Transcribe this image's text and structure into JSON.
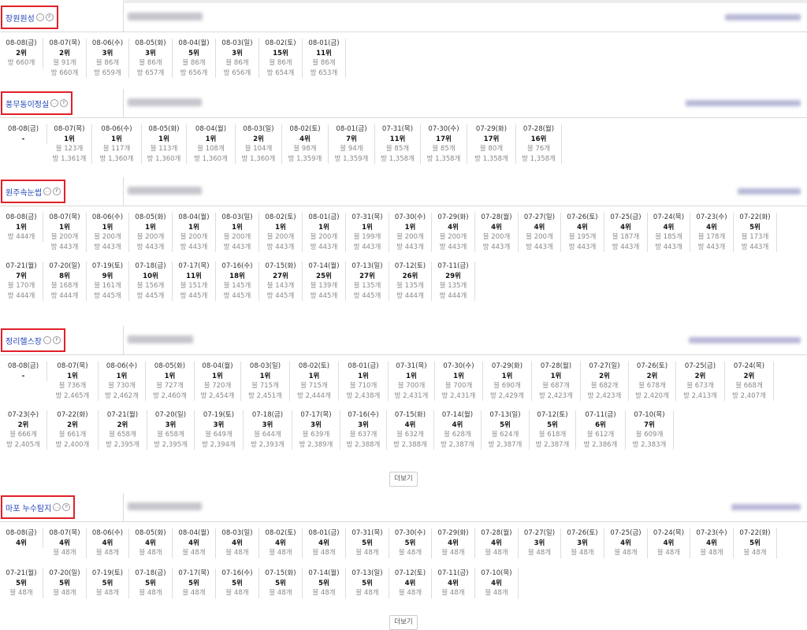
{
  "more_label": "더보기",
  "sections": [
    {
      "keyword": "장원원성",
      "data": [
        [
          "08-08(금)",
          "2위",
          "방 660개"
        ],
        [
          "08-07(목)",
          "2위",
          "블 91개",
          "방 660개"
        ],
        [
          "08-06(수)",
          "3위",
          "블 86개",
          "방 659개"
        ],
        [
          "08-05(화)",
          "3위",
          "블 86개",
          "방 657개"
        ],
        [
          "08-04(월)",
          "5위",
          "블 86개",
          "방 656개"
        ],
        [
          "08-03(일)",
          "3위",
          "블 86개",
          "방 656개"
        ],
        [
          "08-02(토)",
          "15위",
          "블 86개",
          "방 654개"
        ],
        [
          "08-01(금)",
          "11위",
          "블 86개",
          "방 653개"
        ]
      ]
    },
    {
      "keyword": "풍무동이정실",
      "data": [
        [
          "08-08(금)",
          "-"
        ],
        [
          "08-07(목)",
          "1위",
          "블 123개",
          "방 1,361개"
        ],
        [
          "08-06(수)",
          "1위",
          "블 117개",
          "방 1,360개"
        ],
        [
          "08-05(화)",
          "1위",
          "블 113개",
          "방 1,360개"
        ],
        [
          "08-04(월)",
          "1위",
          "블 108개",
          "방 1,360개"
        ],
        [
          "08-03(일)",
          "2위",
          "블 104개",
          "방 1,360개"
        ],
        [
          "08-02(토)",
          "4위",
          "블 98개",
          "방 1,359개"
        ],
        [
          "08-01(금)",
          "7위",
          "블 94개",
          "방 1,359개"
        ],
        [
          "07-31(목)",
          "11위",
          "블 85개",
          "방 1,358개"
        ],
        [
          "07-30(수)",
          "17위",
          "블 85개",
          "방 1,358개"
        ],
        [
          "07-29(화)",
          "17위",
          "블 80개",
          "방 1,358개"
        ],
        [
          "07-28(월)",
          "16위",
          "블 76개",
          "방 1,358개"
        ]
      ]
    },
    {
      "keyword": "원주속눈썹",
      "data": [
        [
          "08-08(금)",
          "1위",
          "방 444개"
        ],
        [
          "08-07(목)",
          "1위",
          "블 200개",
          "방 443개"
        ],
        [
          "08-06(수)",
          "1위",
          "블 200개",
          "방 443개"
        ],
        [
          "08-05(화)",
          "1위",
          "블 200개",
          "방 443개"
        ],
        [
          "08-04(월)",
          "1위",
          "블 200개",
          "방 443개"
        ],
        [
          "08-03(일)",
          "1위",
          "블 200개",
          "방 443개"
        ],
        [
          "08-02(토)",
          "1위",
          "블 200개",
          "방 443개"
        ],
        [
          "08-01(금)",
          "1위",
          "블 200개",
          "방 443개"
        ],
        [
          "07-31(목)",
          "1위",
          "블 199개",
          "방 443개"
        ],
        [
          "07-30(수)",
          "1위",
          "블 200개",
          "방 443개"
        ],
        [
          "07-29(화)",
          "4위",
          "블 200개",
          "방 443개"
        ],
        [
          "07-28(월)",
          "4위",
          "블 200개",
          "방 443개"
        ],
        [
          "07-27(일)",
          "4위",
          "블 200개",
          "방 443개"
        ],
        [
          "07-26(토)",
          "4위",
          "블 195개",
          "방 443개"
        ],
        [
          "07-25(금)",
          "4위",
          "블 187개",
          "방 443개"
        ],
        [
          "07-24(목)",
          "4위",
          "블 185개",
          "방 443개"
        ],
        [
          "07-23(수)",
          "4위",
          "블 178개",
          "방 443개"
        ],
        [
          "07-22(화)",
          "5위",
          "블 173개",
          "방 443개"
        ],
        [
          "07-21(월)",
          "7위",
          "블 170개",
          "방 444개"
        ],
        [
          "07-20(일)",
          "8위",
          "블 168개",
          "방 444개"
        ],
        [
          "07-19(토)",
          "9위",
          "블 161개",
          "방 445개"
        ],
        [
          "07-18(금)",
          "10위",
          "블 156개",
          "방 445개"
        ],
        [
          "07-17(목)",
          "11위",
          "블 151개",
          "방 445개"
        ],
        [
          "07-16(수)",
          "18위",
          "블 145개",
          "방 445개"
        ],
        [
          "07-15(화)",
          "27위",
          "블 143개",
          "방 445개"
        ],
        [
          "07-14(월)",
          "25위",
          "블 139개",
          "방 445개"
        ],
        [
          "07-13(일)",
          "27위",
          "블 135개",
          "방 445개"
        ],
        [
          "07-12(토)",
          "26위",
          "블 135개",
          "방 444개"
        ],
        [
          "07-11(금)",
          "29위",
          "블 135개",
          "방 444개"
        ]
      ]
    },
    {
      "keyword": "정리헬스장",
      "data": [
        [
          "08-08(금)",
          "-"
        ],
        [
          "08-07(목)",
          "1위",
          "블 736개",
          "방 2,465개"
        ],
        [
          "08-06(수)",
          "1위",
          "블 730개",
          "방 2,462개"
        ],
        [
          "08-05(화)",
          "1위",
          "블 727개",
          "방 2,460개"
        ],
        [
          "08-04(월)",
          "1위",
          "블 720개",
          "방 2,454개"
        ],
        [
          "08-03(일)",
          "1위",
          "블 715개",
          "방 2,451개"
        ],
        [
          "08-02(토)",
          "1위",
          "블 715개",
          "방 2,444개"
        ],
        [
          "08-01(금)",
          "1위",
          "블 710개",
          "방 2,438개"
        ],
        [
          "07-31(목)",
          "1위",
          "블 700개",
          "방 2,431개"
        ],
        [
          "07-30(수)",
          "1위",
          "블 700개",
          "방 2,431개"
        ],
        [
          "07-29(화)",
          "1위",
          "블 690개",
          "방 2,429개"
        ],
        [
          "07-28(월)",
          "1위",
          "블 687개",
          "방 2,423개"
        ],
        [
          "07-27(일)",
          "2위",
          "블 682개",
          "방 2,423개"
        ],
        [
          "07-26(토)",
          "2위",
          "블 678개",
          "방 2,420개"
        ],
        [
          "07-25(금)",
          "2위",
          "블 673개",
          "방 2,413개"
        ],
        [
          "07-24(목)",
          "2위",
          "블 668개",
          "방 2,407개"
        ],
        [
          "07-23(수)",
          "2위",
          "블 666개",
          "방 2,405개"
        ],
        [
          "07-22(화)",
          "2위",
          "블 661개",
          "방 2,400개"
        ],
        [
          "07-21(월)",
          "2위",
          "블 658개",
          "방 2,395개"
        ],
        [
          "07-20(일)",
          "3위",
          "블 658개",
          "방 2,395개"
        ],
        [
          "07-19(토)",
          "3위",
          "블 649개",
          "방 2,394개"
        ],
        [
          "07-18(금)",
          "3위",
          "블 644개",
          "방 2,393개"
        ],
        [
          "07-17(목)",
          "3위",
          "블 639개",
          "방 2,389개"
        ],
        [
          "07-16(수)",
          "3위",
          "블 637개",
          "방 2,388개"
        ],
        [
          "07-15(화)",
          "4위",
          "블 632개",
          "방 2,388개"
        ],
        [
          "07-14(월)",
          "4위",
          "블 628개",
          "방 2,387개"
        ],
        [
          "07-13(일)",
          "5위",
          "블 624개",
          "방 2,387개"
        ],
        [
          "07-12(토)",
          "5위",
          "블 618개",
          "방 2,387개"
        ],
        [
          "07-11(금)",
          "6위",
          "블 612개",
          "방 2,386개"
        ],
        [
          "07-10(목)",
          "7위",
          "블 609개",
          "방 2,383개"
        ]
      ]
    },
    {
      "keyword": "마포 누수탐지",
      "data": [
        [
          "08-08(금)",
          "4위"
        ],
        [
          "08-07(목)",
          "4위",
          "블 48개"
        ],
        [
          "08-06(수)",
          "4위",
          "블 48개"
        ],
        [
          "08-05(화)",
          "4위",
          "블 48개"
        ],
        [
          "08-04(월)",
          "4위",
          "블 48개"
        ],
        [
          "08-03(일)",
          "4위",
          "블 48개"
        ],
        [
          "08-02(토)",
          "4위",
          "블 48개"
        ],
        [
          "08-01(금)",
          "4위",
          "블 48개"
        ],
        [
          "07-31(목)",
          "5위",
          "블 48개"
        ],
        [
          "07-30(수)",
          "5위",
          "블 48개"
        ],
        [
          "07-29(화)",
          "4위",
          "블 48개"
        ],
        [
          "07-28(월)",
          "4위",
          "블 48개"
        ],
        [
          "07-27(일)",
          "3위",
          "블 48개"
        ],
        [
          "07-26(토)",
          "3위",
          "블 48개"
        ],
        [
          "07-25(금)",
          "4위",
          "블 48개"
        ],
        [
          "07-24(목)",
          "4위",
          "블 48개"
        ],
        [
          "07-23(수)",
          "4위",
          "블 48개"
        ],
        [
          "07-22(화)",
          "5위",
          "블 48개"
        ],
        [
          "07-21(월)",
          "5위",
          "블 48개"
        ],
        [
          "07-20(일)",
          "5위",
          "블 48개"
        ],
        [
          "07-19(토)",
          "5위",
          "블 48개"
        ],
        [
          "07-18(금)",
          "5위",
          "블 48개"
        ],
        [
          "07-17(목)",
          "5위",
          "블 48개"
        ],
        [
          "07-16(수)",
          "5위",
          "블 48개"
        ],
        [
          "07-15(화)",
          "5위",
          "블 48개"
        ],
        [
          "07-14(월)",
          "5위",
          "블 48개"
        ],
        [
          "07-13(일)",
          "5위",
          "블 48개"
        ],
        [
          "07-12(토)",
          "4위",
          "블 48개"
        ],
        [
          "07-11(금)",
          "4위",
          "블 48개"
        ],
        [
          "07-10(목)",
          "4위",
          "블 48개"
        ]
      ]
    }
  ]
}
